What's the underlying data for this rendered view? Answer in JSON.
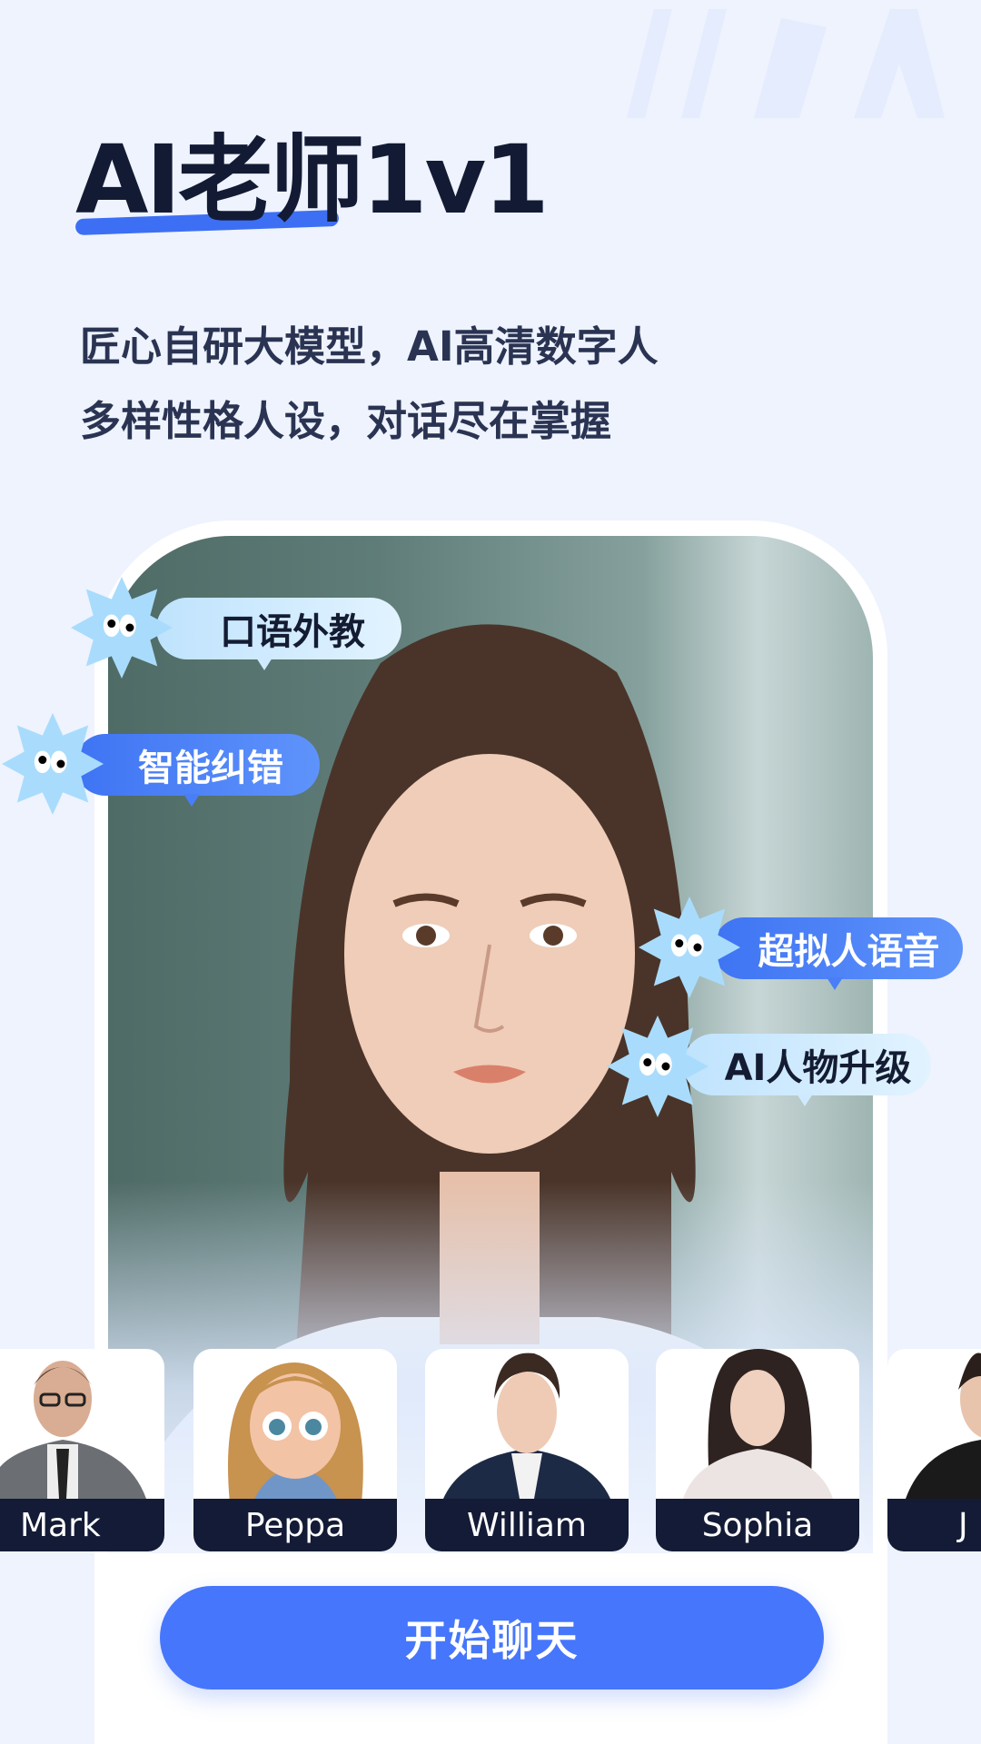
{
  "header": {
    "title": "AI老师1v1",
    "subtitle_lines": [
      "匠心自研大模型，AI高清数字人",
      "多样性格人设，对话尽在掌握"
    ]
  },
  "features": [
    {
      "label": "口语外教",
      "style": "light"
    },
    {
      "label": "智能纠错",
      "style": "blue"
    },
    {
      "label": "超拟人语音",
      "style": "blue"
    },
    {
      "label": "AI人物升级",
      "style": "light"
    }
  ],
  "characters": [
    {
      "name": "Mark"
    },
    {
      "name": "Peppa"
    },
    {
      "name": "William"
    },
    {
      "name": "Sophia"
    },
    {
      "name": "J"
    }
  ],
  "cta": {
    "label": "开始聊天"
  },
  "colors": {
    "background": "#eef3fe",
    "accent": "#4676fb",
    "dark": "#141b36",
    "bubble_light": "#bfe3fd"
  }
}
